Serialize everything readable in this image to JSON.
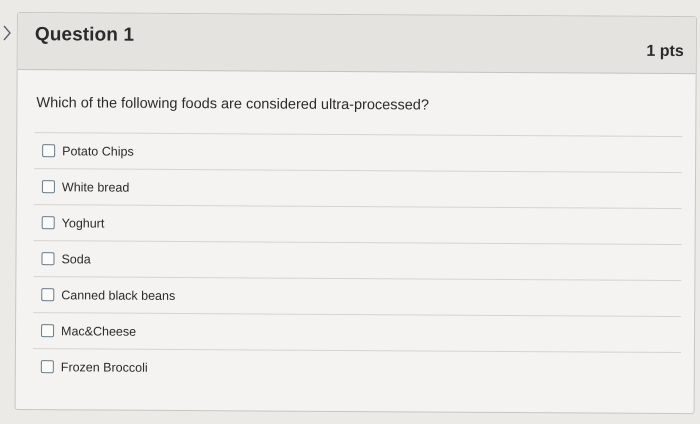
{
  "question": {
    "title": "Question 1",
    "points": "1 pts",
    "text": "Which of the following foods are considered ultra-processed?",
    "answers": [
      {
        "label": "Potato Chips",
        "checked": false
      },
      {
        "label": "White bread",
        "checked": false
      },
      {
        "label": "Yoghurt",
        "checked": false
      },
      {
        "label": "Soda",
        "checked": false
      },
      {
        "label": "Canned black beans",
        "checked": false
      },
      {
        "label": "Mac&Cheese",
        "checked": false
      },
      {
        "label": "Frozen Broccoli",
        "checked": false
      }
    ]
  },
  "icons": {
    "collapse": "chevron-right-icon"
  }
}
